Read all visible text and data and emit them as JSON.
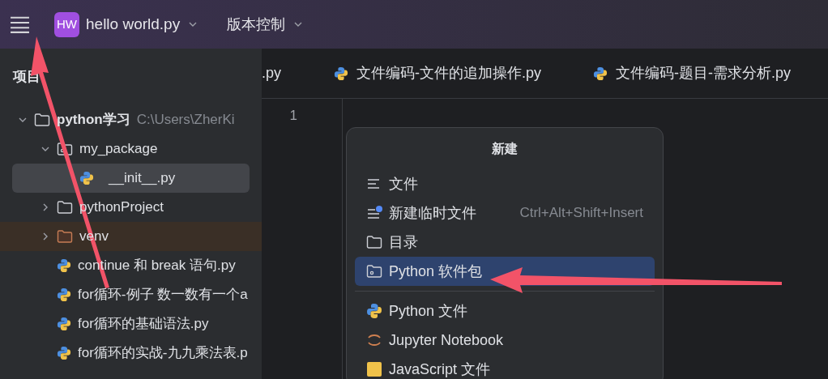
{
  "title_bar": {
    "project_badge": "HW",
    "file_name": "hello world.py",
    "vcs_menu": "版本控制"
  },
  "project_panel": {
    "title": "项目",
    "tree": [
      {
        "label": "python学习",
        "path": "C:\\Users\\ZherKi",
        "kind": "folder",
        "expanded": true,
        "selected": false,
        "children": [
          {
            "label": "my_package",
            "kind": "package",
            "expanded": true,
            "selected": false,
            "children": [
              {
                "label": "__init__.py",
                "kind": "python",
                "selected": true
              }
            ]
          },
          {
            "label": "pythonProject",
            "kind": "folder",
            "expanded": false,
            "selected": false
          },
          {
            "label": "venv",
            "kind": "excluded",
            "expanded": false,
            "selected": false
          },
          {
            "label": "continue 和 break 语句.py",
            "kind": "python",
            "selected": false
          },
          {
            "label": "for循环-例子 数一数有一个a",
            "kind": "python",
            "selected": false
          },
          {
            "label": "for循环的基础语法.py",
            "kind": "python",
            "selected": false
          },
          {
            "label": "for循环的实战-九九乘法表.p",
            "kind": "python",
            "selected": false
          }
        ]
      }
    ]
  },
  "editor": {
    "tabs": [
      {
        "label": ".py",
        "icon": false
      },
      {
        "label": "文件编码-文件的追加操作.py",
        "icon": true
      },
      {
        "label": "文件编码-题目-需求分析.py",
        "icon": true
      }
    ],
    "line_numbers": [
      "1"
    ]
  },
  "new_menu": {
    "title": "新建",
    "groups": [
      [
        {
          "kind": "file",
          "label": "文件",
          "selected": false
        },
        {
          "kind": "scratch",
          "label": "新建临时文件",
          "shortcut": "Ctrl+Alt+Shift+Insert",
          "selected": false
        },
        {
          "kind": "directory",
          "label": "目录",
          "selected": false
        },
        {
          "kind": "package",
          "label": "Python 软件包",
          "selected": true
        }
      ],
      [
        {
          "kind": "python",
          "label": "Python 文件",
          "selected": false
        },
        {
          "kind": "jupyter",
          "label": "Jupyter Notebook",
          "selected": false
        },
        {
          "kind": "javascript",
          "label": "JavaScript 文件",
          "selected": false
        }
      ]
    ]
  }
}
